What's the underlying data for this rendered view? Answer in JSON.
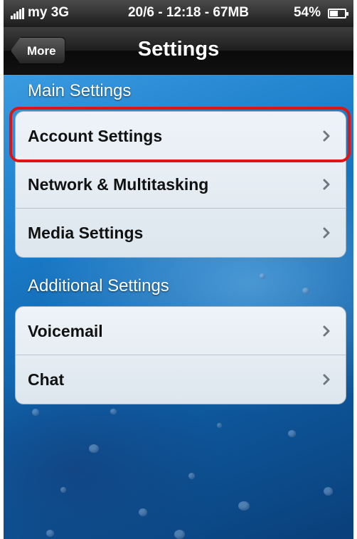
{
  "status_bar": {
    "carrier": "my  3G",
    "center_text": "20/6 - 12:18 - 67MB",
    "battery_percent_text": "54%",
    "battery_level": 0.54,
    "icons": [
      "signal-bars-icon",
      "battery-icon"
    ]
  },
  "nav": {
    "back_label": "More",
    "title": "Settings"
  },
  "sections": [
    {
      "header": "Main Settings",
      "items": [
        {
          "label": "Account Settings",
          "icon": "chevron-right-icon"
        },
        {
          "label": "Network & Multitasking",
          "icon": "chevron-right-icon"
        },
        {
          "label": "Media Settings",
          "icon": "chevron-right-icon"
        }
      ]
    },
    {
      "header": "Additional Settings",
      "items": [
        {
          "label": "Voicemail",
          "icon": "chevron-right-icon"
        },
        {
          "label": "Chat",
          "icon": "chevron-right-icon"
        }
      ]
    }
  ],
  "highlight": {
    "target": "Account Settings",
    "color": "#e01414"
  },
  "colors": {
    "nav_bar": "#1e1e1e",
    "wallpaper": "#1a7bc8",
    "row_background": "#eef3f8"
  }
}
